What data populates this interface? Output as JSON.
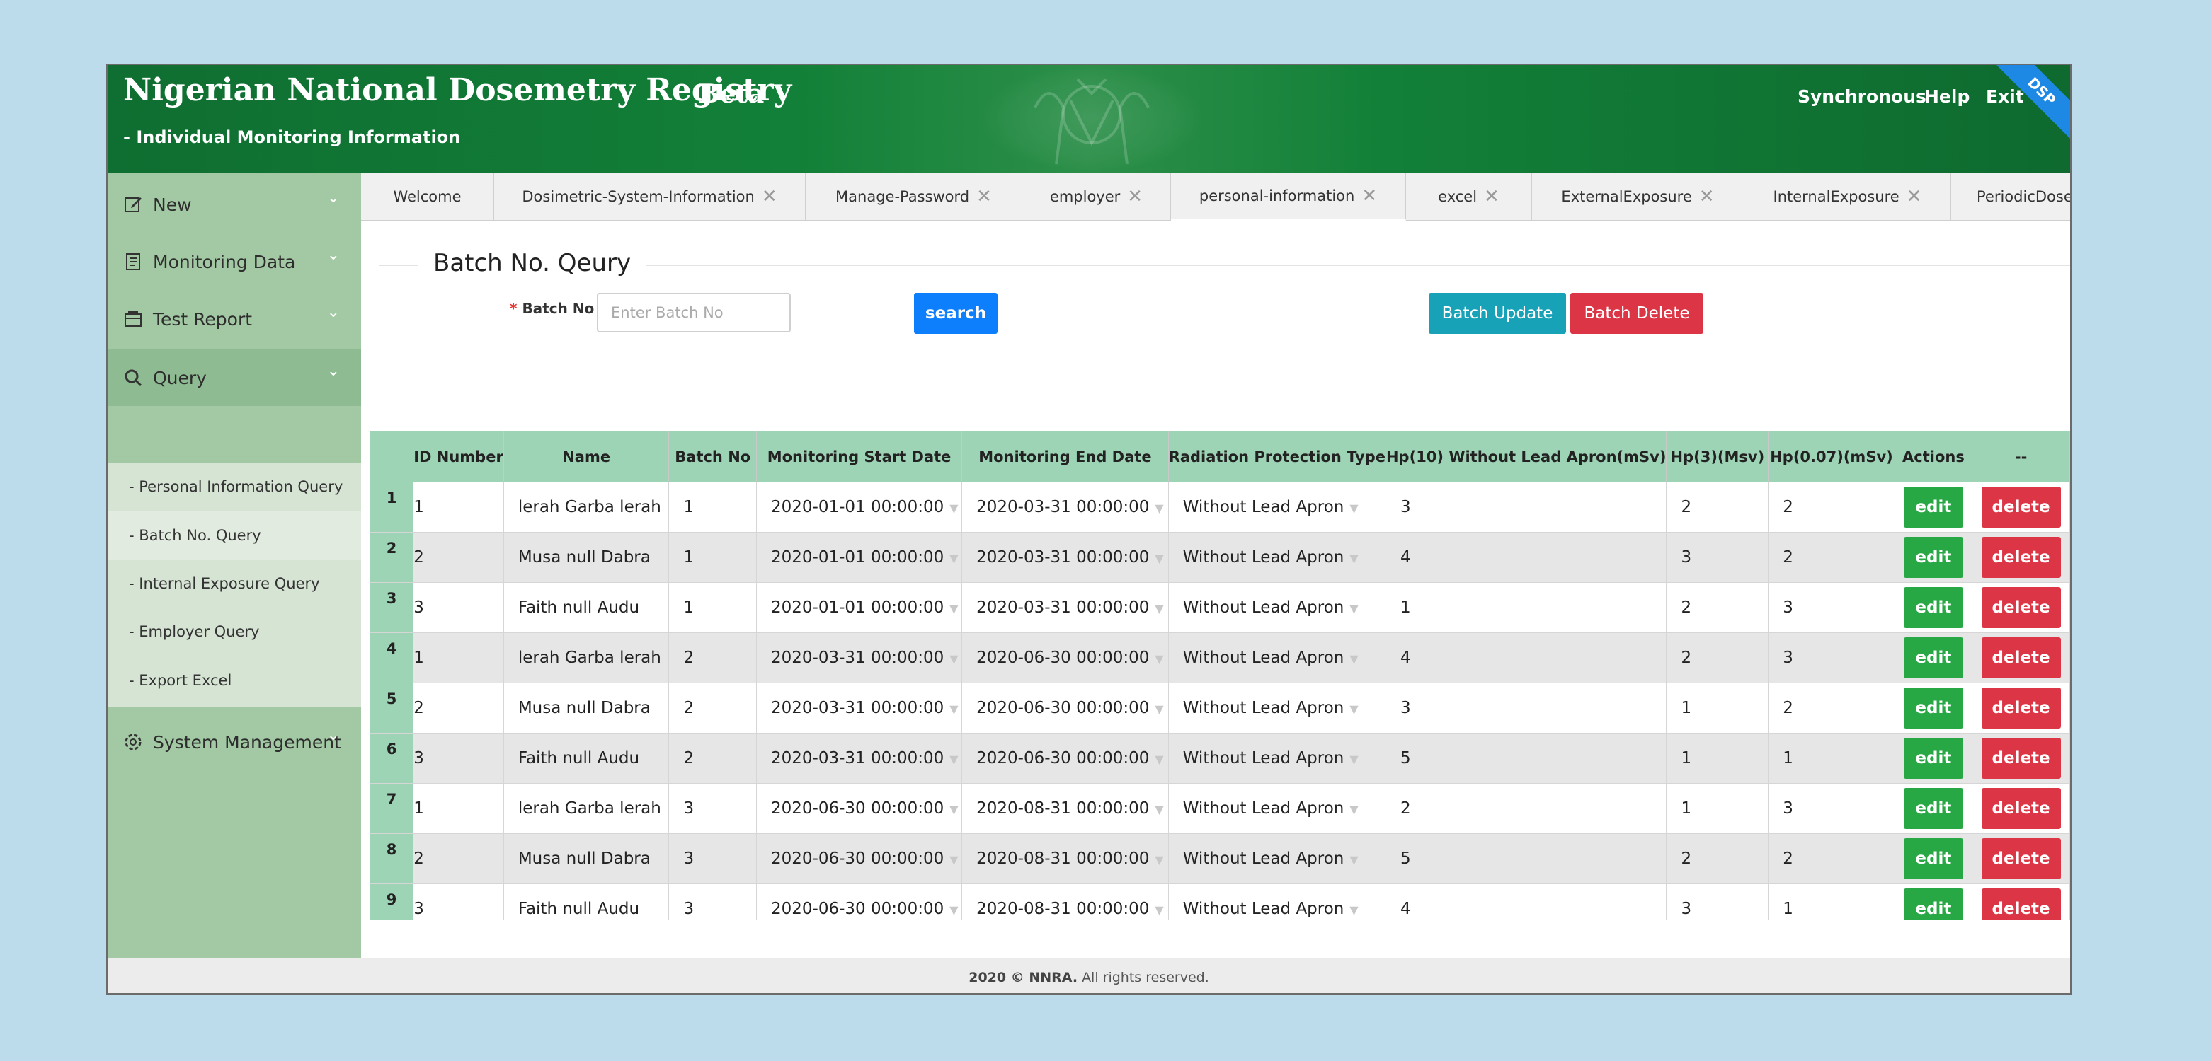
{
  "header": {
    "title": "Nigerian National Dosemetry Registry",
    "beta": "Beta",
    "subtitle": "- Individual Monitoring Information",
    "links": [
      "Synchronous",
      "Help",
      "Exit"
    ],
    "ribbon": "DSP",
    "color": "#128038"
  },
  "sidebar": {
    "items": [
      {
        "label": "New",
        "icon": "edit-icon"
      },
      {
        "label": "Monitoring Data",
        "icon": "document-icon"
      },
      {
        "label": "Test Report",
        "icon": "report-icon"
      },
      {
        "label": "Query",
        "icon": "search-icon"
      },
      {
        "label": "System Management",
        "icon": "gear-icon"
      }
    ],
    "submenu": [
      "- Personal Information Query",
      "- Batch No. Query",
      "- Internal Exposure Query",
      "- Employer Query",
      "- Export Excel"
    ]
  },
  "tabs": [
    {
      "label": "Welcome"
    },
    {
      "label": "Dosimetric-System-Information"
    },
    {
      "label": "Manage-Password"
    },
    {
      "label": "employer"
    },
    {
      "label": "personal-information"
    },
    {
      "label": "excel"
    },
    {
      "label": "ExternalExposure"
    },
    {
      "label": "InternalExposure"
    },
    {
      "label": "PeriodicDose"
    }
  ],
  "main": {
    "title": "Batch No. Qeury",
    "batch_label": "Batch No",
    "batch_required": "*",
    "batch_placeholder": "Enter Batch No",
    "batch_value": "",
    "search_label": "search",
    "batch_update_label": "Batch Update",
    "batch_delete_label": "Batch Delete"
  },
  "table": {
    "columns": [
      "",
      "ID Number",
      "Name",
      "Batch No",
      "Monitoring Start Date",
      "Monitoring End Date",
      "Radiation Protection Type",
      "Hp(10) Without Lead Apron(mSv)",
      "Hp(3)(Msv)",
      "Hp(0.07)(mSv)",
      "Actions",
      "--"
    ],
    "edit_label": "edit",
    "delete_label": "delete",
    "rows": [
      {
        "n": "1",
        "id": "1",
        "name": "lerah Garba lerah",
        "batch": "1",
        "start": "2020-01-01 00:00:00",
        "end": "2020-03-31 00:00:00",
        "type": "Without Lead Apron",
        "hp10": "3",
        "hp3": "2",
        "hp007": "2"
      },
      {
        "n": "2",
        "id": "2",
        "name": "Musa null Dabra",
        "batch": "1",
        "start": "2020-01-01 00:00:00",
        "end": "2020-03-31 00:00:00",
        "type": "Without Lead Apron",
        "hp10": "4",
        "hp3": "3",
        "hp007": "2"
      },
      {
        "n": "3",
        "id": "3",
        "name": "Faith null Audu",
        "batch": "1",
        "start": "2020-01-01 00:00:00",
        "end": "2020-03-31 00:00:00",
        "type": "Without Lead Apron",
        "hp10": "1",
        "hp3": "2",
        "hp007": "3"
      },
      {
        "n": "4",
        "id": "1",
        "name": "lerah Garba lerah",
        "batch": "2",
        "start": "2020-03-31 00:00:00",
        "end": "2020-06-30 00:00:00",
        "type": "Without Lead Apron",
        "hp10": "4",
        "hp3": "2",
        "hp007": "3"
      },
      {
        "n": "5",
        "id": "2",
        "name": "Musa null Dabra",
        "batch": "2",
        "start": "2020-03-31 00:00:00",
        "end": "2020-06-30 00:00:00",
        "type": "Without Lead Apron",
        "hp10": "3",
        "hp3": "1",
        "hp007": "2"
      },
      {
        "n": "6",
        "id": "3",
        "name": "Faith null Audu",
        "batch": "2",
        "start": "2020-03-31 00:00:00",
        "end": "2020-06-30 00:00:00",
        "type": "Without Lead Apron",
        "hp10": "5",
        "hp3": "1",
        "hp007": "1"
      },
      {
        "n": "7",
        "id": "1",
        "name": "lerah Garba lerah",
        "batch": "3",
        "start": "2020-06-30 00:00:00",
        "end": "2020-08-31 00:00:00",
        "type": "Without Lead Apron",
        "hp10": "2",
        "hp3": "1",
        "hp007": "3"
      },
      {
        "n": "8",
        "id": "2",
        "name": "Musa null Dabra",
        "batch": "3",
        "start": "2020-06-30 00:00:00",
        "end": "2020-08-31 00:00:00",
        "type": "Without Lead Apron",
        "hp10": "5",
        "hp3": "2",
        "hp007": "2"
      },
      {
        "n": "9",
        "id": "3",
        "name": "Faith null Audu",
        "batch": "3",
        "start": "2020-06-30 00:00:00",
        "end": "2020-08-31 00:00:00",
        "type": "Without Lead Apron",
        "hp10": "4",
        "hp3": "3",
        "hp007": "1"
      }
    ]
  },
  "footer": {
    "brand": "2020 © NNRA.",
    "text": "All rights reserved."
  }
}
